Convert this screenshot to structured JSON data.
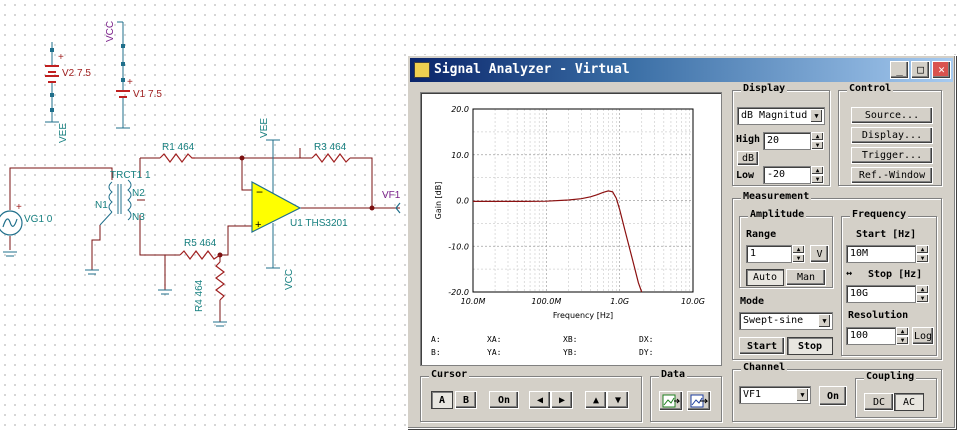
{
  "schematic": {
    "v2_label": "V2 7.5",
    "v1_label": "V1 7.5",
    "vee_top": "VEE",
    "vcc_top": "VCC",
    "r1": "R1 464",
    "r3": "R3 464",
    "r5": "R5 464",
    "r4": "R4 464",
    "vee_amp": "VEE",
    "vcc_amp": "VCC",
    "opamp": "U1 THS3201",
    "trans": "TRCT1 1",
    "n1": "N1",
    "n2": "N2",
    "n3": "N3",
    "source": "VG1 0",
    "output": "VF1",
    "plus": "+"
  },
  "window": {
    "title": "Signal Analyzer - Virtual",
    "minimize": "_",
    "maximize": "□",
    "close": "✕"
  },
  "chart_data": {
    "type": "line",
    "xlabel": "Frequency [Hz]",
    "ylabel": "Gain [dB]",
    "x_scale": "log",
    "xlim": [
      10000000,
      10000000000
    ],
    "ylim": [
      -20,
      20
    ],
    "x_ticks": [
      "10.0M",
      "100.0M",
      "1.0G",
      "10.0G"
    ],
    "y_ticks": [
      "20.0",
      "10.0",
      "0.0",
      "-10.0",
      "-20.0"
    ],
    "grid": true,
    "series": [
      {
        "color": "#8b1010",
        "x": [
          10000000,
          20000000,
          50000000,
          100000000,
          200000000,
          300000000,
          400000000,
          500000000,
          600000000,
          700000000,
          800000000,
          900000000,
          1000000000,
          1200000000,
          1500000000,
          1800000000,
          2000000000
        ],
        "y": [
          -0.2,
          -0.2,
          -0.2,
          -0.15,
          0.1,
          0.4,
          0.8,
          1.3,
          1.8,
          2.1,
          1.9,
          0.5,
          -2.0,
          -7.0,
          -13.0,
          -18.0,
          -20.0
        ]
      }
    ]
  },
  "cursor_readout": {
    "a": "A:",
    "xa": "XA:",
    "xb": "XB:",
    "dx": "DX:",
    "b": "B:",
    "ya": "YA:",
    "yb": "YB:",
    "dy": "DY:"
  },
  "display": {
    "legend": "Display",
    "mode_value": "dB Magnitud",
    "high_label": "High",
    "high_value": "20",
    "db_button": "dB",
    "low_label": "Low",
    "low_value": "-20"
  },
  "control": {
    "legend": "Control",
    "source": "Source...",
    "display": "Display...",
    "trigger": "Trigger...",
    "ref_window": "Ref.-Window"
  },
  "measurement": {
    "legend": "Measurement",
    "amplitude_legend": "Amplitude",
    "range_label": "Range",
    "range_value": "1",
    "range_unit": "V",
    "auto": "Auto",
    "man": "Man",
    "mode_label": "Mode",
    "mode_value": "Swept-sine",
    "start_button": "Start",
    "stop_button": "Stop",
    "frequency_legend": "Frequency",
    "start_label": "Start [Hz]",
    "start_value": "10M",
    "stop_label": "Stop [Hz]",
    "stop_value": "10G",
    "resolution_label": "Resolution",
    "resolution_value": "100",
    "log_button": "Log"
  },
  "cursor": {
    "legend": "Cursor",
    "a": "A",
    "b": "B",
    "on": "On",
    "left": "◀",
    "right": "▶",
    "up": "▲",
    "down": "▼"
  },
  "data": {
    "legend": "Data"
  },
  "channel": {
    "legend": "Channel",
    "value": "VF1",
    "on": "On"
  },
  "coupling": {
    "legend": "Coupling",
    "dc": "DC",
    "ac": "AC"
  }
}
